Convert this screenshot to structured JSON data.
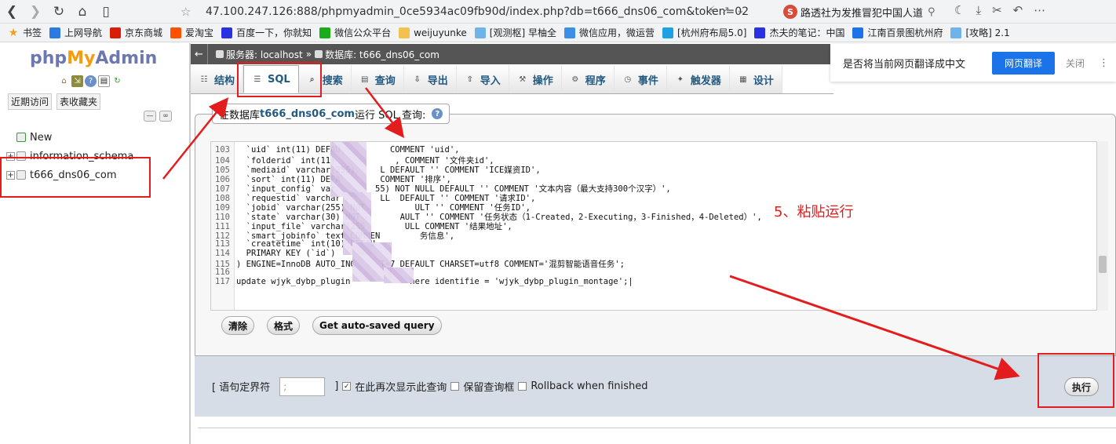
{
  "browser": {
    "url": "47.100.247.126:888/phpmyadmin_0ce5934ac09fb90d/index.php?db=t666_dns06_com&token=02",
    "search_text": "路透社为发推冒犯中国人道"
  },
  "bookmarks": [
    {
      "label": "书签",
      "color": "#f0a020"
    },
    {
      "label": "上网导航",
      "color": "#2a7ae2"
    },
    {
      "label": "京东商城",
      "color": "#d81e06"
    },
    {
      "label": "爱淘宝",
      "color": "#ff5000"
    },
    {
      "label": "百度一下，你就知",
      "color": "#2932e1"
    },
    {
      "label": "微信公众平台",
      "color": "#1aad19"
    },
    {
      "label": "weijuyunke",
      "color": "#f2c14e"
    },
    {
      "label": "[观测枢] 早柚全",
      "color": "#6fb3e8"
    },
    {
      "label": "微信应用，微运营",
      "color": "#3c8ee6"
    },
    {
      "label": "[杭州府布局5.0]",
      "color": "#1fa0e0"
    },
    {
      "label": "杰夫的笔记：中国",
      "color": "#2932e1"
    },
    {
      "label": "江南百景图杭州府",
      "color": "#1a73e8"
    },
    {
      "label": "[攻略] 2.1",
      "color": "#6fb3e8"
    }
  ],
  "pma": {
    "logo_php": "php",
    "logo_my": "My",
    "logo_admin": "Admin",
    "recent": "近期访问",
    "favorites": "表收藏夹",
    "tree": [
      "New",
      "information_schema",
      "t666_dns06_com"
    ]
  },
  "breadcrumb": {
    "server": "服务器: localhost",
    "sep": "»",
    "database": "数据库: t666_dns06_com"
  },
  "tabs": [
    {
      "label": "结构",
      "icon": "structure-icon"
    },
    {
      "label": "SQL",
      "icon": "sql-icon"
    },
    {
      "label": "搜索",
      "icon": "search-icon"
    },
    {
      "label": "查询",
      "icon": "query-icon"
    },
    {
      "label": "导出",
      "icon": "export-icon"
    },
    {
      "label": "导入",
      "icon": "import-icon"
    },
    {
      "label": "操作",
      "icon": "wrench-icon"
    },
    {
      "label": "程序",
      "icon": "routines-icon"
    },
    {
      "label": "事件",
      "icon": "events-icon"
    },
    {
      "label": "触发器",
      "icon": "triggers-icon"
    },
    {
      "label": "设计",
      "icon": "designer-icon"
    }
  ],
  "translate": {
    "prompt": "是否将当前网页翻译成中文",
    "button": "网页翻译",
    "close": "关闭"
  },
  "query_box": {
    "legend_prefix": "在数据库 ",
    "legend_db": "t666_dns06_com",
    "legend_suffix": " 运行 SQL 查询:"
  },
  "code_lines": [
    {
      "n": "103",
      "t": "  `uid` int(11) DEFAU          COMMENT 'uid',"
    },
    {
      "n": "104",
      "t": "  `folderid` int(11)            , COMMENT '文件夹id',"
    },
    {
      "n": "105",
      "t": "  `mediaid` varchar(255)     L DEFAULT '' COMMENT 'ICE媒资ID',"
    },
    {
      "n": "106",
      "t": "  `sort` int(11) DEFA        COMMENT '排序',"
    },
    {
      "n": "107",
      "t": "  `input_config` var        55) NOT NULL DEFAULT '' COMMENT '文本内容（最大支持300个汉字）',"
    },
    {
      "n": "108",
      "t": "  `requestid` varchar        LL  DEFAULT '' COMMENT '请求ID',"
    },
    {
      "n": "109",
      "t": "  `jobid` varchar(255) NOT          ULT '' COMMENT '任务ID',"
    },
    {
      "n": "110",
      "t": "  `state` varchar(30) NOT        AULT '' COMMENT '任务状态（1-Created，2-Executing，3-Finished，4-Deleted）',"
    },
    {
      "n": "111",
      "t": "  `input_file` varchar(255        ULL COMMENT '结果地址',"
    },
    {
      "n": "112",
      "t": "  `smart_jobinfo` text COMMEN        务信息',"
    },
    {
      "n": "113",
      "t": "  `createtime` int(10) DEFAU"
    },
    {
      "n": "114",
      "t": "  PRIMARY KEY (`id`)"
    },
    {
      "n": "115",
      "t": ") ENGINE=InnoDB AUTO_INC     T=7 DEFAULT CHARSET=utf8 COMMENT='混剪智能语音任务';"
    },
    {
      "n": "116",
      "t": ""
    },
    {
      "n": "117",
      "t": "update wjyk_dybp_plugin            here identifie = 'wjyk_dybp_plugin_montage';|"
    }
  ],
  "annotation": "5、粘贴运行",
  "buttons": {
    "clear": "清除",
    "format": "格式",
    "autosaved": "Get auto-saved query"
  },
  "footer": {
    "delimiter_label_open": "[ 语句定界符",
    "delimiter_value": ";",
    "delimiter_label_close": "]",
    "show_again": "在此再次显示此查询",
    "retain_box": "保留查询框",
    "rollback": "Rollback when finished",
    "execute": "执行"
  }
}
